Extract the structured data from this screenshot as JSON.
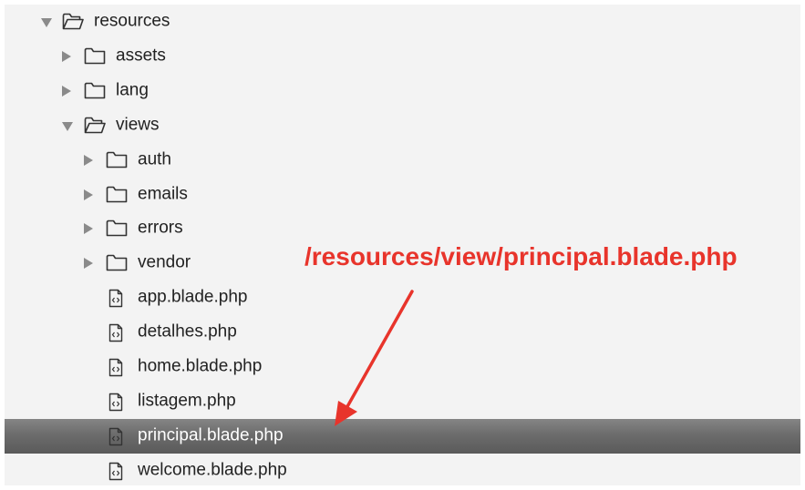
{
  "tree": [
    {
      "label": "resources",
      "kind": "folder",
      "state": "open",
      "depth": 0,
      "name": "tree-node-resources"
    },
    {
      "label": "assets",
      "kind": "folder",
      "state": "closed",
      "depth": 1,
      "name": "tree-node-assets"
    },
    {
      "label": "lang",
      "kind": "folder",
      "state": "closed",
      "depth": 1,
      "name": "tree-node-lang"
    },
    {
      "label": "views",
      "kind": "folder",
      "state": "open",
      "depth": 1,
      "name": "tree-node-views"
    },
    {
      "label": "auth",
      "kind": "folder",
      "state": "closed",
      "depth": 2,
      "name": "tree-node-auth"
    },
    {
      "label": "emails",
      "kind": "folder",
      "state": "closed",
      "depth": 2,
      "name": "tree-node-emails"
    },
    {
      "label": "errors",
      "kind": "folder",
      "state": "closed",
      "depth": 2,
      "name": "tree-node-errors"
    },
    {
      "label": "vendor",
      "kind": "folder",
      "state": "closed",
      "depth": 2,
      "name": "tree-node-vendor"
    },
    {
      "label": "app.blade.php",
      "kind": "file",
      "depth": 2,
      "name": "tree-file-app-blade-php"
    },
    {
      "label": "detalhes.php",
      "kind": "file",
      "depth": 2,
      "name": "tree-file-detalhes-php"
    },
    {
      "label": "home.blade.php",
      "kind": "file",
      "depth": 2,
      "name": "tree-file-home-blade-php"
    },
    {
      "label": "listagem.php",
      "kind": "file",
      "depth": 2,
      "name": "tree-file-listagem-php"
    },
    {
      "label": "principal.blade.php",
      "kind": "file",
      "depth": 2,
      "selected": true,
      "name": "tree-file-principal-blade-php"
    },
    {
      "label": "welcome.blade.php",
      "kind": "file",
      "depth": 2,
      "name": "tree-file-welcome-blade-php"
    }
  ],
  "annotation": {
    "text": "/resources/view/principal.blade.php",
    "color": "#e8342b"
  },
  "colors": {
    "panel_bg": "#f3f3f3",
    "selected_row": "#6c6c6c",
    "icon_stroke": "#333333",
    "disclosure": "#8a8a8a"
  }
}
